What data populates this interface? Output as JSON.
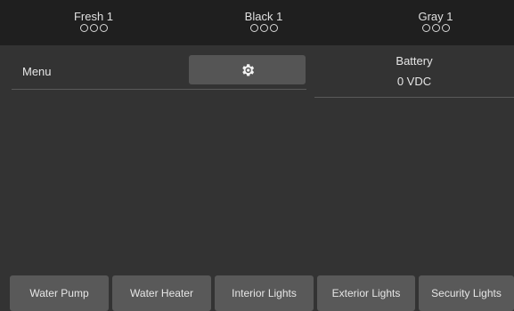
{
  "tanks": [
    {
      "name": "Fresh 1",
      "icon": "level-dots-icon"
    },
    {
      "name": "Black 1",
      "icon": "level-dots-icon"
    },
    {
      "name": "Gray 1",
      "icon": "level-dots-icon"
    }
  ],
  "menu": {
    "label": "Menu",
    "settings_icon": "gear-icon"
  },
  "battery": {
    "label": "Battery",
    "value": "0 VDC"
  },
  "controls": [
    {
      "label": "Water Pump"
    },
    {
      "label": "Water Heater"
    },
    {
      "label": "Interior Lights"
    },
    {
      "label": "Exterior Lights"
    },
    {
      "label": "Security Lights"
    }
  ],
  "colors": {
    "background": "#333333",
    "topbar": "#1f1f1f",
    "button": "#595959",
    "text": "#e6e6e6"
  }
}
